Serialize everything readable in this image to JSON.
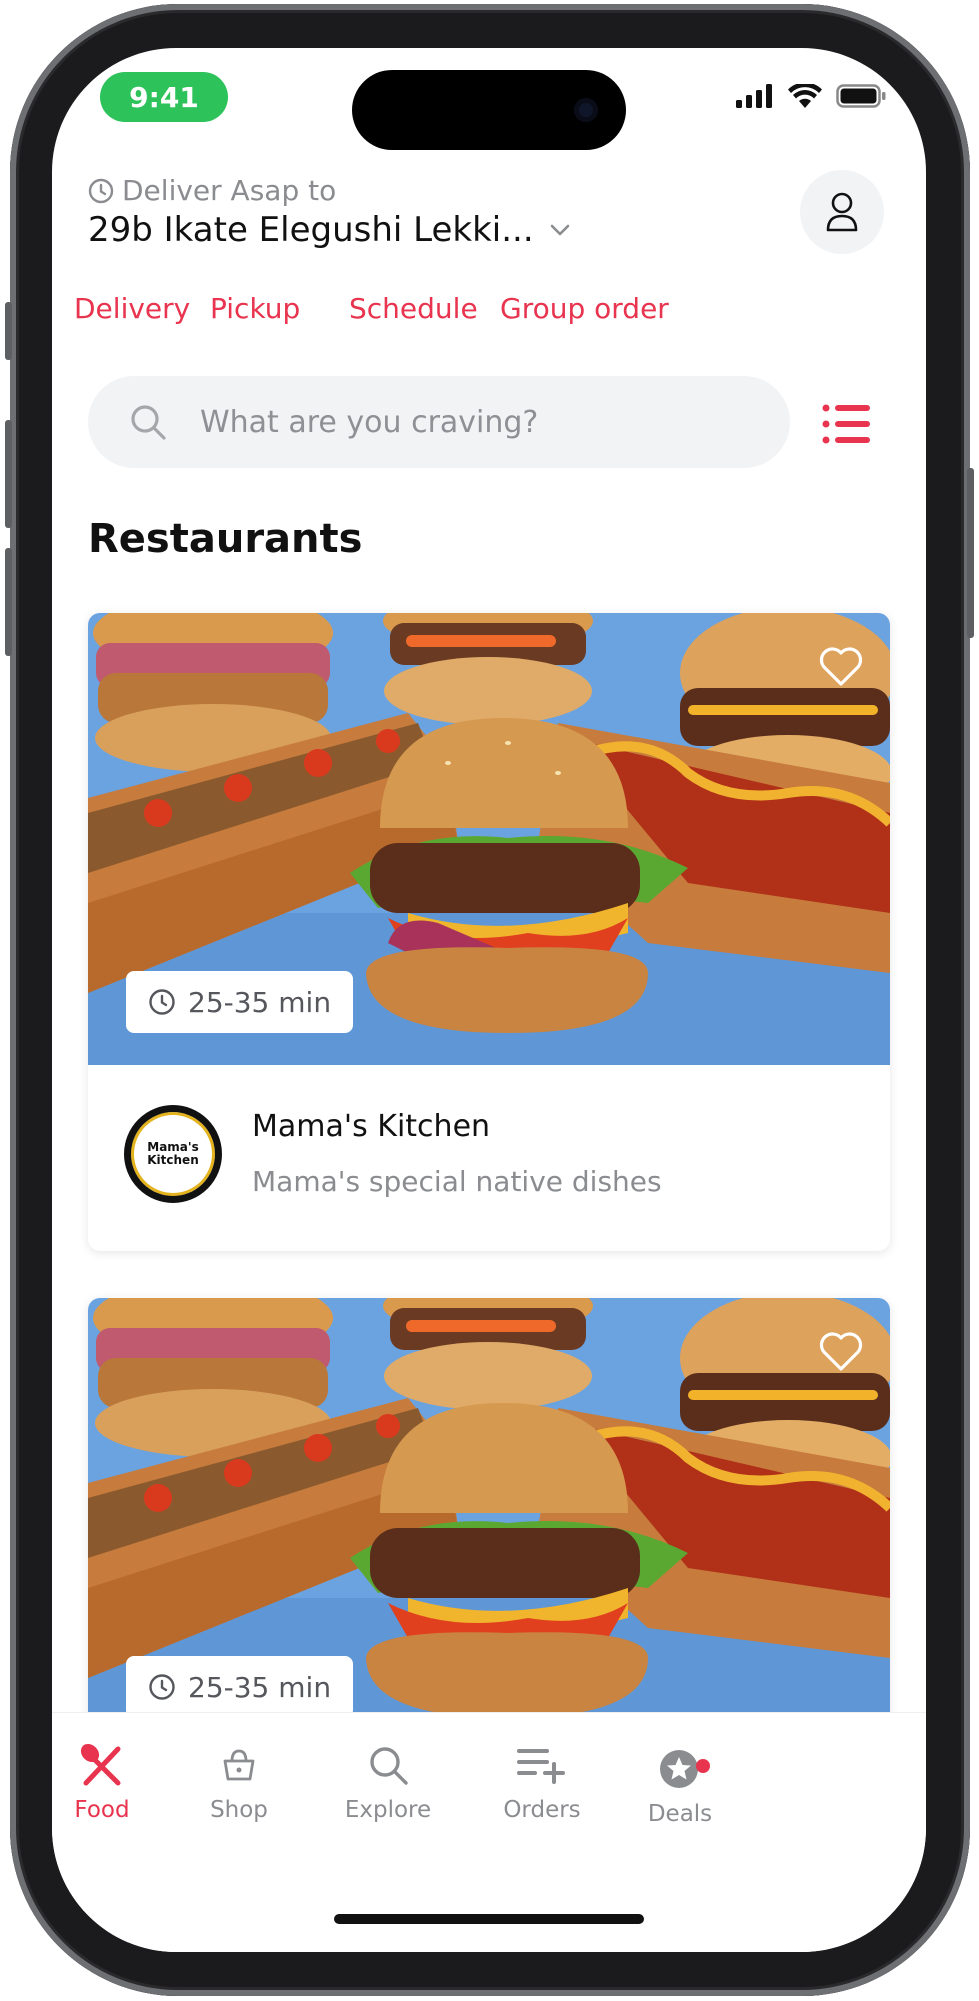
{
  "status_bar": {
    "time": "9:41"
  },
  "header": {
    "deliver_label": "Deliver Asap to",
    "address": "29b Ikate Elegushi Lekki..."
  },
  "modes": [
    "Delivery",
    "Pickup",
    "Schedule",
    "Group order"
  ],
  "search": {
    "placeholder": "What are you craving?"
  },
  "section_title": "Restaurants",
  "restaurants": [
    {
      "eta": "25-35 min",
      "name": "Mama's Kitchen",
      "description": "Mama's special native dishes",
      "logo_text": "Mama's Kitchen"
    },
    {
      "eta": "25-35 min"
    }
  ],
  "tabs": [
    {
      "label": "Food",
      "icon": "fork-knife-icon",
      "active": true
    },
    {
      "label": "Shop",
      "icon": "basket-icon"
    },
    {
      "label": "Explore",
      "icon": "search-icon"
    },
    {
      "label": "Orders",
      "icon": "list-add-icon"
    },
    {
      "label": "Deals",
      "icon": "star-badge-icon",
      "badge": true
    }
  ],
  "colors": {
    "accent": "#e8344e",
    "time_pill": "#2ec35a",
    "image_background": "#6aa3e0"
  }
}
